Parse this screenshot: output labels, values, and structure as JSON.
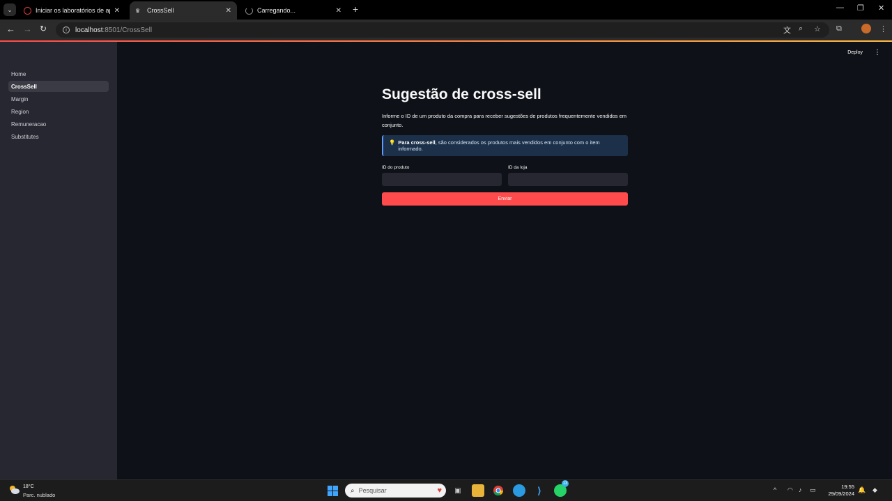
{
  "browser": {
    "tabs": [
      {
        "title": "Iniciar os laboratórios de apren",
        "favicon": "spinner-red-icon",
        "active": false
      },
      {
        "title": "CrossSell",
        "favicon": "crown-icon",
        "active": true
      },
      {
        "title": "Carregando...",
        "favicon": "loading-icon",
        "active": false
      }
    ],
    "url_host": "localhost",
    "url_path": ":8501/CrossSell"
  },
  "sidebar": {
    "items": [
      {
        "label": "Home"
      },
      {
        "label": "CrossSell"
      },
      {
        "label": "Margin"
      },
      {
        "label": "Region"
      },
      {
        "label": "Remuneracao"
      },
      {
        "label": "Substitutes"
      }
    ],
    "active_index": 1
  },
  "header": {
    "deploy_label": "Deploy"
  },
  "main": {
    "title": "Sugestão de cross-sell",
    "description": "Informe o ID de um produto da compra para receber sugestões de produtos frequentemente vendidos em conjunto.",
    "info_bold": "Para cross-sell",
    "info_rest": ", são considerados os produtos mais vendidos em conjunto com o item informado.",
    "product_label": "ID do produto",
    "store_label": "ID da loja",
    "product_value": "",
    "store_value": "",
    "submit_label": "Enviar"
  },
  "taskbar": {
    "weather_temp": "18°C",
    "weather_desc": "Parc. nublado",
    "search_placeholder": "Pesquisar",
    "whatsapp_badge": "13",
    "time": "19:55",
    "date": "29/09/2024"
  },
  "colors": {
    "accent": "#ff4b4b",
    "sidebar_bg": "#262730",
    "main_bg": "#0e1117",
    "info_bg": "#1c3149"
  }
}
